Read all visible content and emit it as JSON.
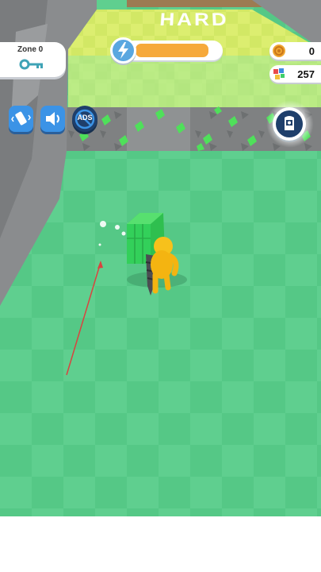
{
  "level": {
    "difficulty": "HARD"
  },
  "zone": {
    "label": "Zone 0",
    "icon": "key-icon"
  },
  "energy": {
    "icon": "lightning-icon",
    "fill_fraction": 0.87,
    "fill_color": "#f6a93b"
  },
  "currency": {
    "coins": {
      "value": "0",
      "icon": "coin-icon"
    },
    "gems": {
      "value": "257",
      "icon": "gem-icon"
    }
  },
  "settings": {
    "vibration": {
      "icon": "vibration-icon"
    },
    "sound": {
      "icon": "speaker-icon"
    },
    "ads": {
      "label": "ADS",
      "icon": "no-ads-icon"
    }
  },
  "skin_button": {
    "icon": "skin-icon"
  },
  "colors": {
    "floor": "#5fcf8f",
    "cube": "#33d05a",
    "player": "#f7c11b",
    "wall": "#8c8e90",
    "hard_zone": "#d8ec6a"
  }
}
